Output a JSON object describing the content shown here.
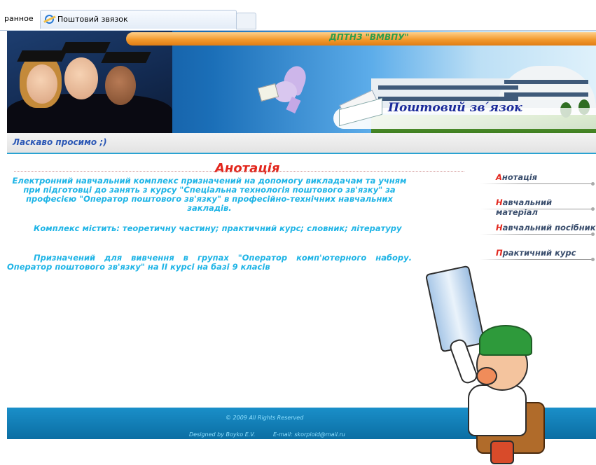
{
  "browser": {
    "favorites_label": "ранное",
    "tab_title": "Поштовий звязок"
  },
  "header": {
    "site_name": "ДПТНЗ \"ВМВПУ\"",
    "banner_title": "Поштовий зв ́язок"
  },
  "welcome": {
    "text": "Ласкаво просимо    ;)"
  },
  "content": {
    "heading": "Анотація",
    "paragraphs": [
      "Електронний навчальний комплекс призначений на допомогу викладачам та учням при підготовці до занять з курсу \"Спеціальна технологія поштового зв'язку\" за професією \"Оператор поштового зв'язку\" в професійно-технічних навчальних закладів.",
      "Комплекс містить: теоретичну частину; практичний курс; словник; літературу",
      "Призначений для вивчення в групах \"Оператор комп'ютерного набору. Оператор поштового зв'язку\" на ІІ курсі на базі 9 класів"
    ]
  },
  "menu": {
    "items": [
      {
        "first": "А",
        "rest": "нотація"
      },
      {
        "first": "Н",
        "rest": "авчальний матеріал"
      },
      {
        "first": "Н",
        "rest": "авчальний посібник"
      },
      {
        "first": "П",
        "rest": "рактичний курс"
      }
    ]
  },
  "footer": {
    "copyright": "© 2009 All Rights Reserved",
    "designed": "Designed by Boyko E.V.",
    "email": "E-mail: skorpioid@mail.ru"
  },
  "colors": {
    "accent": "#e2261c",
    "text_cyan": "#1eb4e6",
    "footer": "#0b6ea3"
  }
}
